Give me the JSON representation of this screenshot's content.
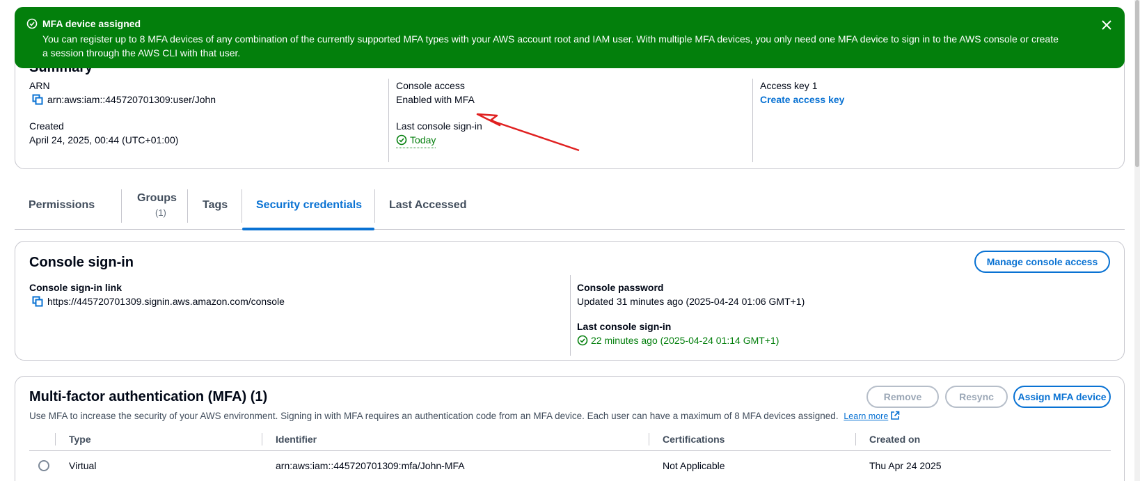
{
  "flash": {
    "title": "MFA device assigned",
    "message": "You can register up to 8 MFA devices of any combination of the currently supported MFA types with your AWS account root and IAM user. With multiple MFA devices, you only need one MFA device to sign in to the AWS console or create a session through the AWS CLI with that user.",
    "icon": "check-circle-icon",
    "close_icon": "close-icon",
    "color": "#037f0c"
  },
  "summary": {
    "title": "Summary",
    "arn_label": "ARN",
    "arn_value": "arn:aws:iam::445720701309:user/John",
    "created_label": "Created",
    "created_value": "April 24, 2025, 00:44 (UTC+01:00)",
    "console_access_label": "Console access",
    "console_access_value": "Enabled with MFA",
    "last_signin_label": "Last console sign-in",
    "last_signin_value": "Today",
    "access_key_label": "Access key 1",
    "access_key_link": "Create access key"
  },
  "tabs": [
    {
      "label": "Permissions",
      "count": ""
    },
    {
      "label": "Groups",
      "count": "(1)"
    },
    {
      "label": "Tags",
      "count": ""
    },
    {
      "label": "Security credentials",
      "count": "",
      "active": true
    },
    {
      "label": "Last Accessed",
      "count": ""
    }
  ],
  "console_signin": {
    "title": "Console sign-in",
    "manage_button": "Manage console access",
    "link_label": "Console sign-in link",
    "link_value": "https://445720701309.signin.aws.amazon.com/console",
    "password_label": "Console password",
    "password_value": "Updated 31 minutes ago (2025-04-24 01:06 GMT+1)",
    "last_signin_label": "Last console sign-in",
    "last_signin_value": "22 minutes ago (2025-04-24 01:14 GMT+1)"
  },
  "mfa": {
    "title": "Multi-factor authentication (MFA) (1)",
    "remove_button": "Remove",
    "resync_button": "Resync",
    "assign_button": "Assign MFA device",
    "description": "Use MFA to increase the security of your AWS environment. Signing in with MFA requires an authentication code from an MFA device. Each user can have a maximum of 8 MFA devices assigned.",
    "learn_more": "Learn more",
    "columns": [
      "Type",
      "Identifier",
      "Certifications",
      "Created on"
    ],
    "rows": [
      [
        "Virtual",
        "arn:aws:iam::445720701309:mfa/John-MFA",
        "Not Applicable",
        "Thu Apr 24 2025"
      ]
    ]
  },
  "colors": {
    "accent": "#0972d3",
    "success": "#037f0c",
    "annotation_arrow": "#e02020"
  }
}
